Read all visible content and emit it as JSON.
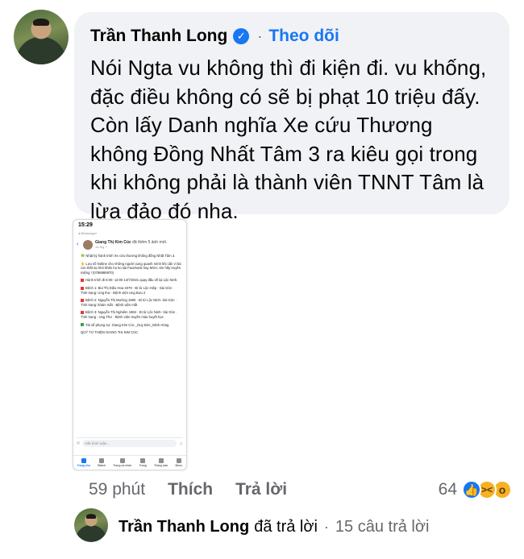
{
  "comment": {
    "author": "Trần Thanh Long",
    "follow_label": "Theo dõi",
    "separator": "·",
    "text": "Nói Ngta vu không thì đi kiện đi. vu khống, đặc điều không có sẽ bị phạt 10 triệu đấy. Còn lấy Danh nghĩa Xe cứu Thương không Đồng Nhất Tâm 3 ra kiêu gọi trong khi không phải là thành viên TNNT Tâm là lừa đảo đó nha.",
    "time": "59 phút",
    "like_label": "Thích",
    "reply_label": "Trả lời",
    "reaction_count": "64",
    "reactions": [
      "like-icon",
      "haha-icon",
      "wow-icon"
    ]
  },
  "attachment": {
    "status_time": "15:29",
    "status_sub": "◂ Messenger",
    "poster": "Giang Thị Kim Cúc",
    "post_action": "đã thêm 5 ảnh mới.",
    "post_time": "14 thg 7 · ",
    "lines": [
      "🍀 Nhật ký hành trình Xe cứu thương không đồng Nhất Tâm 3.",
      "✋ Lưu số hotline cho những người xung quanh mình khi cần vì bà con thất sự khó khăn họ ko sài Facebook hay MXH..Xin hãy truyền miệng ! (0788886970)",
      "Hành trình đi 6:00- 12:00 14/7/2021 quay đầu về lại Lộc Ninh.",
      "Bệnh 1: Bùi Thị Diệu Hoa 1979 · Đi từ Lộc Hiệp - Sài Gòn · Tình trạng: Ung thư · Bệnh viện Ung Bưu 2",
      "Bệnh 2: Nguyễn Thị Mường 1980 · Đi từ Lộc Ninh- Sài Gòn · Tình trạng: khám mắt · Bệnh viện mắt",
      "Bệnh 3: Nguyễn Thị Nghiêm 1984 · Đi từ Lộc Ninh- Sài Gòn · Tình trạng : Ung Thư · Bệnh viện truyền máu huyết học",
      "Tài xế phụng sự: Giang Kim Cúc _Duy Đức_Minh Hùng",
      "QUỸ TỪ THIỆN GIANG THỊ KIM CÚC"
    ],
    "comment_placeholder": "Viết bình luận...",
    "nav": [
      "Trang chủ",
      "Watch",
      "Trang cá nhân",
      "Trang",
      "Thông báo",
      "Menu"
    ]
  },
  "reply": {
    "author": "Trần Thanh Long",
    "action": "đã trả lời",
    "separator": "·",
    "count": "15 câu trả lời"
  },
  "colors": {
    "accent": "#1877f2",
    "bubble": "#f0f2f5",
    "muted": "#65676b"
  }
}
